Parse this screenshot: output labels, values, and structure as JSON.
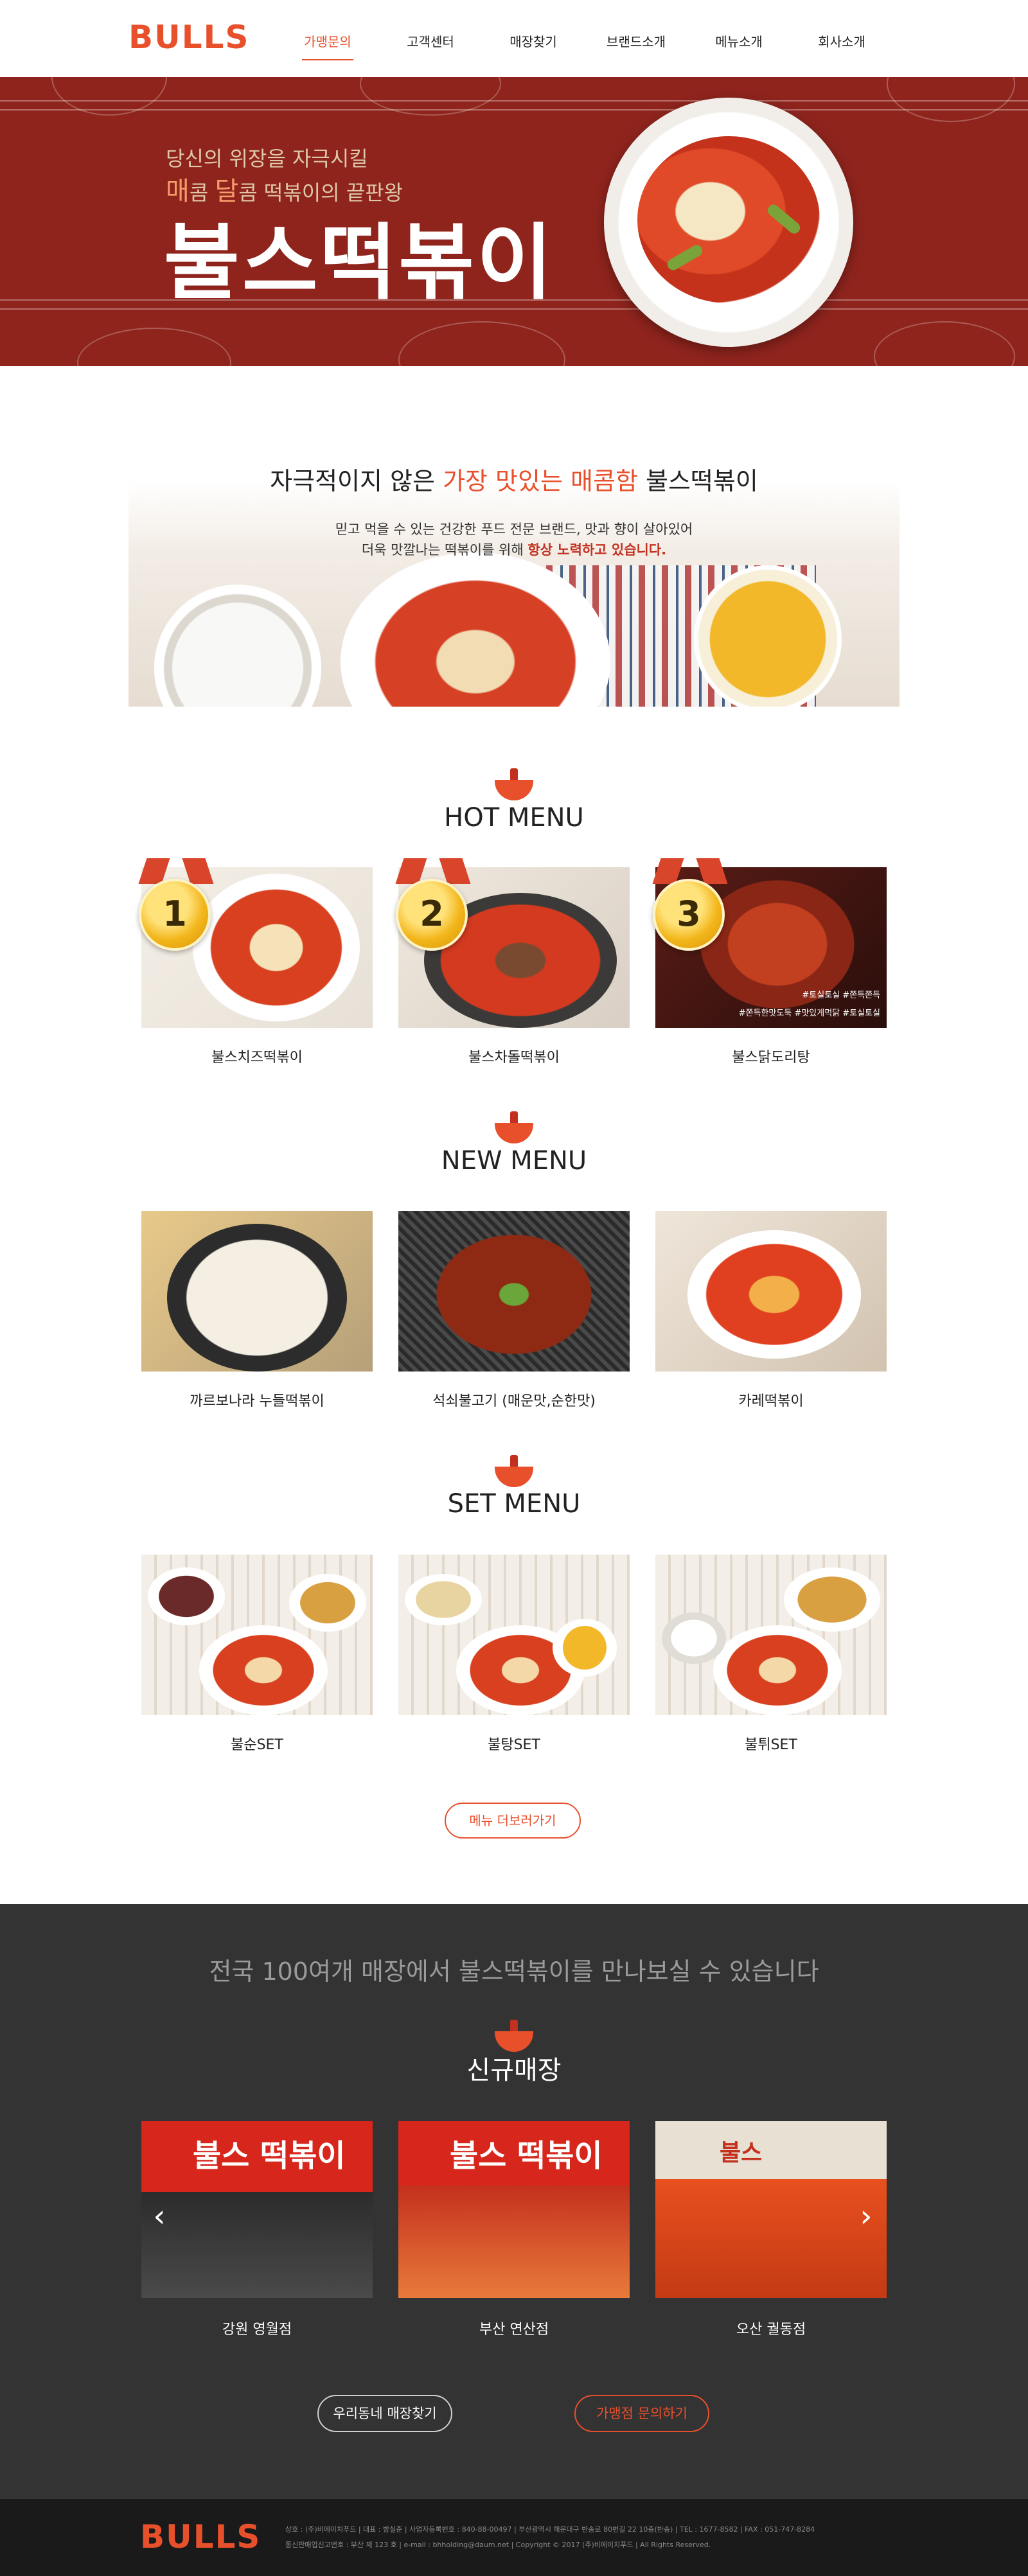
{
  "header": {
    "logo": "BULLS",
    "nav": [
      "가맹문의",
      "고객센터",
      "매장찾기",
      "브랜드소개",
      "메뉴소개",
      "회사소개"
    ]
  },
  "hero": {
    "line1": "당신의 위장을 자극시킬",
    "line2_highlight": "매",
    "line2_a": "콤 ",
    "line2_highlight2": "달",
    "line2_b": "콤 떡볶이의 끝판왕",
    "title": "불스떡볶이"
  },
  "intro": {
    "title_a": "자극적이지 않은 ",
    "title_hl1": "가장 맛있는",
    "title_b": " ",
    "title_hl2": "매콤함",
    "title_c": " 불스떡볶이",
    "desc1": "믿고 먹을 수 있는 건강한 푸드 전문 브랜드, 맛과 향이 살아있어",
    "desc2_a": "더욱 맛깔나는 떡볶이를 위해 ",
    "desc2_hl": "항상 노력하고 있습니다."
  },
  "hot_menu": {
    "title": "HOT MENU",
    "items": [
      {
        "rank": "1",
        "label": "불스치즈떡볶이"
      },
      {
        "rank": "2",
        "label": "불스차돌떡볶이"
      },
      {
        "rank": "3",
        "label": "불스닭도리탕",
        "tags1": "#토실토실 #쫀득쫀득",
        "tags2": "#쫀득한맛도둑 #맛있게먹닭 #토실토실"
      }
    ]
  },
  "new_menu": {
    "title": "NEW MENU",
    "items": [
      {
        "label": "까르보나라 누들떡볶이"
      },
      {
        "label": "석쇠불고기 (매운맛,순한맛)"
      },
      {
        "label": "카레떡볶이"
      }
    ]
  },
  "set_menu": {
    "title": "SET MENU",
    "items": [
      {
        "label": "불순SET"
      },
      {
        "label": "불탕SET"
      },
      {
        "label": "불튀SET"
      }
    ],
    "more_button": "메뉴 더보러가기"
  },
  "stores": {
    "headline": "전국 100여개 매장에서 불스떡볶이를 만나보실 수 있습니다",
    "title": "신규매장",
    "items": [
      {
        "label": "강원 영월점",
        "sign": "불스 떡볶이"
      },
      {
        "label": "부산 연산점",
        "sign": "불스 떡볶이"
      },
      {
        "label": "오산 궐동점",
        "sign": "불스"
      }
    ],
    "btn_find": "우리동네 매장찾기",
    "btn_franchise": "가맹점 문의하기"
  },
  "footer": {
    "logo": "BULLS",
    "line1": "상호 : (주)비에이치푸드  |  대표 : 방실준  |  사업자등록번호 : 840-88-00497  |  부산광역시 해운대구 반송로 80번길 22 10층(반송)  |  TEL : 1677-8582  |  FAX : 051-747-8284",
    "line2": "통신판매업신고번호 : 부산 제 123 호  |  e-mail : bhholding@daum.net  |  Copyright © 2017 (주)비에이치푸드 | All Rights Reserved."
  },
  "colors": {
    "accent": "#e8502c",
    "hero_bg": "#8f241d",
    "dark_section": "#333333",
    "footer_bg": "#1a1a1a"
  },
  "icons": [
    "bowl-fork-icon",
    "chevron-left-icon",
    "chevron-right-icon",
    "medal-icon"
  ]
}
